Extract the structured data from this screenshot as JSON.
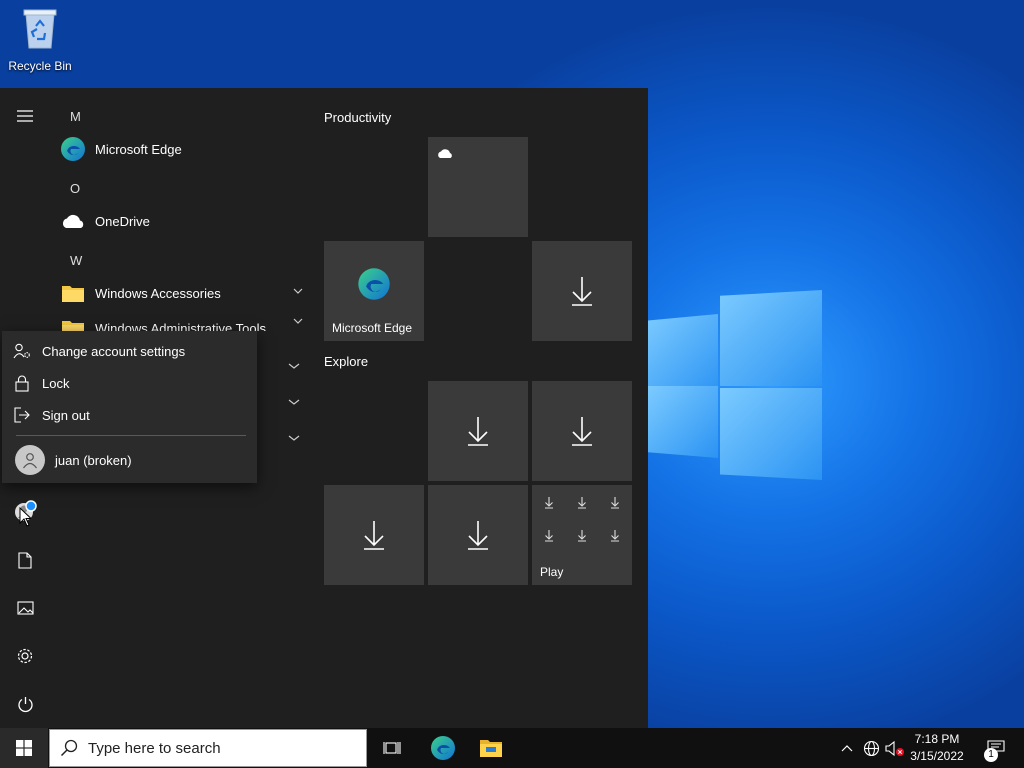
{
  "desktop": {
    "icons": [
      {
        "label": "Recycle Bin",
        "icon": "recycle-bin-icon"
      }
    ]
  },
  "start_menu": {
    "applist": {
      "letters": [
        "M",
        "O",
        "W"
      ],
      "apps": [
        {
          "label": "Microsoft Edge",
          "icon": "edge-icon"
        },
        {
          "label": "OneDrive",
          "icon": "onedrive-icon"
        },
        {
          "label": "Windows Accessories",
          "icon": "folder-icon",
          "expandable": true
        },
        {
          "label": "Windows Administrative Tools",
          "icon": "folder-icon",
          "expandable": true
        }
      ]
    },
    "tile_groups": [
      {
        "title": "Productivity"
      },
      {
        "title": "Explore"
      }
    ],
    "tiles": {
      "edge_label": "Microsoft Edge",
      "play_label": "Play"
    },
    "rail": [
      "menu-icon",
      "user-icon",
      "document-icon",
      "pictures-icon",
      "settings-icon",
      "power-icon"
    ]
  },
  "account_flyout": {
    "items": [
      {
        "label": "Change account settings",
        "icon": "account-settings-icon"
      },
      {
        "label": "Lock",
        "icon": "lock-icon"
      },
      {
        "label": "Sign out",
        "icon": "sign-out-icon"
      }
    ],
    "user": {
      "label": "juan (broken)",
      "icon": "avatar-icon"
    }
  },
  "taskbar": {
    "search_placeholder": "Type here to search",
    "clock_time": "7:18 PM",
    "clock_date": "3/15/2022",
    "notification_count": "1"
  },
  "colors": {
    "start_bg": "#1f1f1f",
    "tile_bg": "#3a3a3a",
    "flyout_bg": "#2b2b2b",
    "taskbar_bg": "#101010",
    "folder": "#f3c743"
  }
}
